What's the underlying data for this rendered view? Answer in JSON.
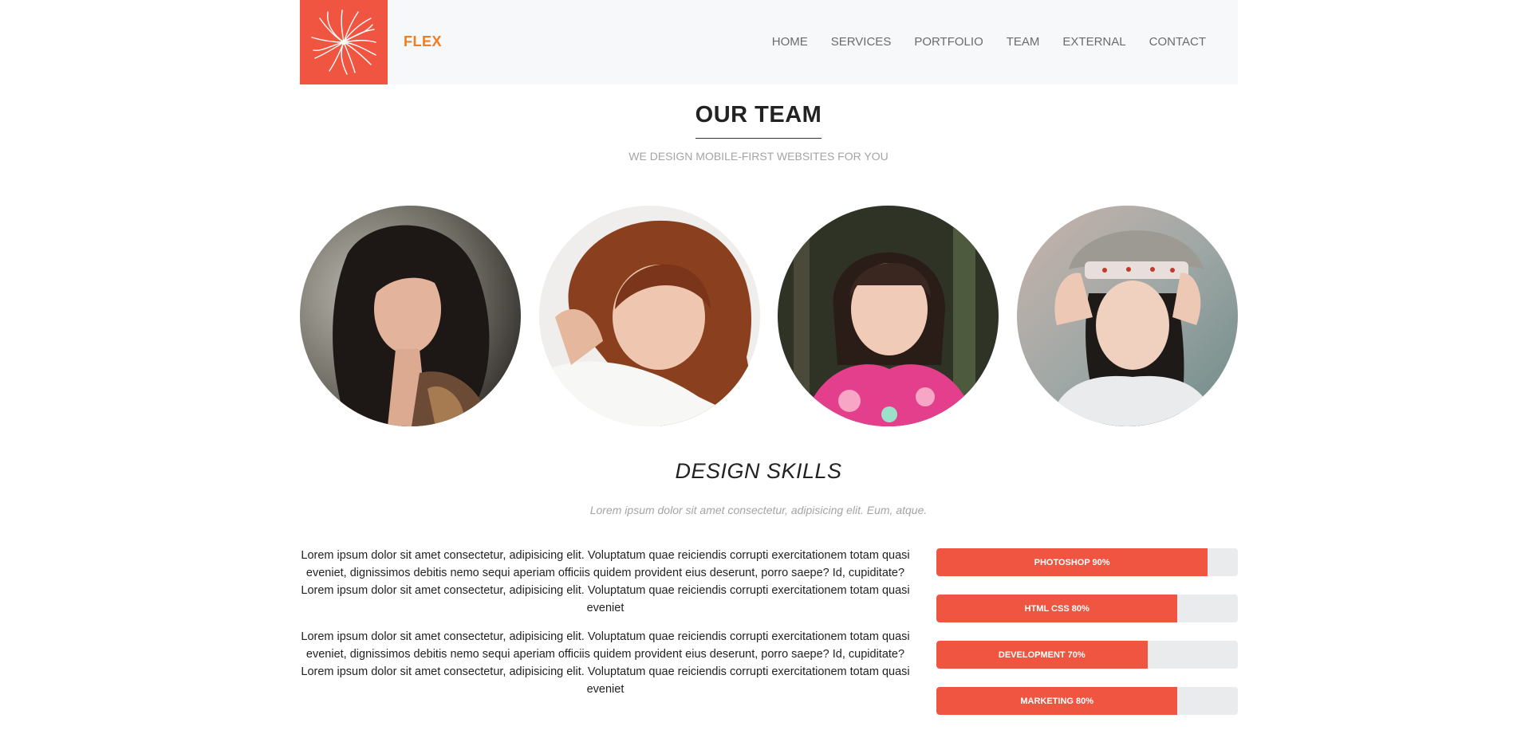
{
  "brand": {
    "name": "FLEX",
    "color": "#f07d1f",
    "logo_bg": "#ef5540",
    "logo_icon": "flower-burst-icon"
  },
  "nav": {
    "items": [
      {
        "label": "HOME"
      },
      {
        "label": "SERVICES"
      },
      {
        "label": "PORTFOLIO"
      },
      {
        "label": "TEAM"
      },
      {
        "label": "EXTERNAL"
      },
      {
        "label": "CONTACT"
      }
    ]
  },
  "team": {
    "title": "OUR TEAM",
    "subtitle": "WE DESIGN MOBILE-FIRST WEBSITES FOR YOU",
    "members": [
      {
        "photo": "team-member-photo-1"
      },
      {
        "photo": "team-member-photo-2"
      },
      {
        "photo": "team-member-photo-3"
      },
      {
        "photo": "team-member-photo-4"
      }
    ]
  },
  "skills": {
    "title": "DESIGN SKILLS",
    "subtitle": "Lorem ipsum dolor sit amet consectetur, adipisicing elit. Eum, atque.",
    "paragraphs": [
      "Lorem ipsum dolor sit amet consectetur, adipisicing elit. Voluptatum quae reiciendis corrupti exercitationem totam quasi eveniet, dignissimos debitis nemo sequi aperiam officiis quidem provident eius deserunt, porro saepe? Id, cupiditate?Lorem ipsum dolor sit amet consectetur, adipisicing elit. Voluptatum quae reiciendis corrupti exercitationem totam quasi eveniet",
      "Lorem ipsum dolor sit amet consectetur, adipisicing elit. Voluptatum quae reiciendis corrupti exercitationem totam quasi eveniet, dignissimos debitis nemo sequi aperiam officiis quidem provident eius deserunt, porro saepe? Id, cupiditate?Lorem ipsum dolor sit amet consectetur, adipisicing elit. Voluptatum quae reiciendis corrupti exercitationem totam quasi eveniet"
    ],
    "bars": [
      {
        "label": "PHOTOSHOP 90%",
        "percent": 90
      },
      {
        "label": "HTML CSS 80%",
        "percent": 80
      },
      {
        "label": "DEVELOPMENT 70%",
        "percent": 70
      },
      {
        "label": "MARKETING 80%",
        "percent": 80
      }
    ],
    "bar_color": "#ef5540",
    "track_color": "#e9ebed"
  }
}
